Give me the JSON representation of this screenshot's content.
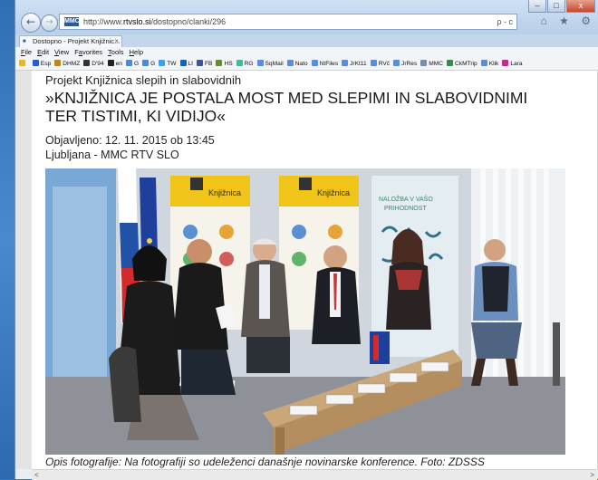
{
  "browser": {
    "url_prefix": "http://www.",
    "url_host": "rtvslo.si",
    "url_path": "/dostopno/clanki/296",
    "site_icon": "MMC",
    "tab_label": "Dostopno - Projekt Knjižnic...",
    "tab_close": "×",
    "address_tools": "ρ - c",
    "right_icons": "⌂ ★ ⚙",
    "window_controls": {
      "minimize": "–",
      "maximize": "□",
      "close": "x"
    },
    "nav_back": "←",
    "nav_forward": "→"
  },
  "menu": [
    {
      "label": "File",
      "key": "F"
    },
    {
      "label": "Edit",
      "key": "E"
    },
    {
      "label": "View",
      "key": "V"
    },
    {
      "label": "Favorites",
      "key": "a"
    },
    {
      "label": "Tools",
      "key": "T"
    },
    {
      "label": "Help",
      "key": "H"
    }
  ],
  "favorites": [
    {
      "label": "Esp",
      "color": "#2a5ec2"
    },
    {
      "label": "DHMZ",
      "color": "#b8862a"
    },
    {
      "label": "D'94",
      "color": "#333"
    },
    {
      "label": "en",
      "color": "#222"
    },
    {
      "label": "G",
      "color": "#4a8ad6"
    },
    {
      "label": "G",
      "color": "#4a8ad6"
    },
    {
      "label": "TW",
      "color": "#38a1f3"
    },
    {
      "label": "LI",
      "color": "#0a66c2"
    },
    {
      "label": "FB",
      "color": "#3b5998"
    },
    {
      "label": "HS",
      "color": "#6a8a3a"
    },
    {
      "label": "RG",
      "color": "#40ba9b"
    },
    {
      "label": "SqMail",
      "color": "#5b8ed8"
    },
    {
      "label": "Nato",
      "color": "#5b8ed8"
    },
    {
      "label": "NtFiles",
      "color": "#5b8ed8"
    },
    {
      "label": "JrKt11",
      "color": "#5b8ed8"
    },
    {
      "label": "RVč",
      "color": "#5b8ed8"
    },
    {
      "label": "JrRes",
      "color": "#5b8ed8"
    },
    {
      "label": "MMC",
      "color": "#7a8da8"
    },
    {
      "label": "CkMTrip",
      "color": "#3a8a4a"
    },
    {
      "label": "Klik",
      "color": "#5b8ed8"
    },
    {
      "label": "Lara",
      "color": "#c22a8e"
    }
  ],
  "article": {
    "kicker": "Projekt Knjižnica slepih in slabovidnih",
    "headline": "»KNJIŽNICA JE POSTALA MOST MED SLEPIMI IN SLABOVIDNIMI TER TISTIMI, KI VIDIJO«",
    "published": "Objavljeno: 12. 11. 2015 ob 13:45",
    "location": "Ljubljana - MMC RTV SLO",
    "caption": "Opis fotografije: Na fotografiji so udeleženci današnje novinarske konference. Foto: ZDSSS"
  },
  "photo": {
    "banner1_title": "Knjižnica",
    "banner2_title": "Knjižnica",
    "banner3_line1": "NALOŽBA V VAŠO",
    "banner3_line2": "PRIHODNOST"
  },
  "scroll": {
    "up": "▲",
    "down": "▼",
    "left": "<",
    "right": ">"
  }
}
